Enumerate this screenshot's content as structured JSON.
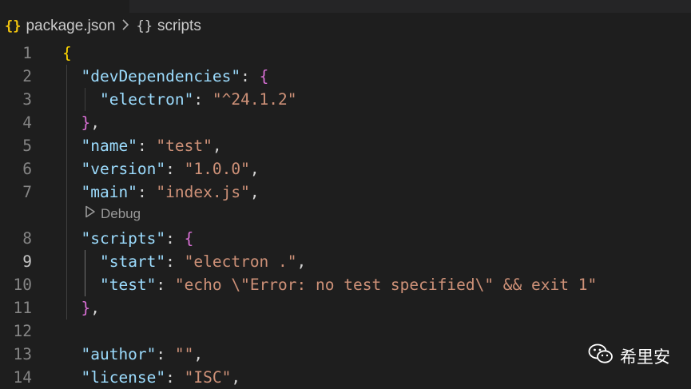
{
  "breadcrumb": {
    "file_icon": "{}",
    "file": "package.json",
    "separator": "chevron-right-icon",
    "section_icon": "{}",
    "section": "scripts"
  },
  "code_lens": {
    "label": "Debug",
    "icon": "play-icon"
  },
  "lines": [
    {
      "n": "1",
      "seg": [
        {
          "t": "{",
          "c": "b1"
        }
      ]
    },
    {
      "n": "2",
      "seg": [
        {
          "t": "  "
        },
        {
          "t": "\"devDependencies\"",
          "c": "key"
        },
        {
          "t": ": "
        },
        {
          "t": "{",
          "c": "b2"
        }
      ]
    },
    {
      "n": "3",
      "seg": [
        {
          "t": "    "
        },
        {
          "t": "\"electron\"",
          "c": "key"
        },
        {
          "t": ": "
        },
        {
          "t": "\"^24.1.2\"",
          "c": "str"
        }
      ]
    },
    {
      "n": "4",
      "seg": [
        {
          "t": "  "
        },
        {
          "t": "}",
          "c": "b2"
        },
        {
          "t": ","
        }
      ]
    },
    {
      "n": "5",
      "seg": [
        {
          "t": "  "
        },
        {
          "t": "\"name\"",
          "c": "key"
        },
        {
          "t": ": "
        },
        {
          "t": "\"test\"",
          "c": "str"
        },
        {
          "t": ","
        }
      ]
    },
    {
      "n": "6",
      "seg": [
        {
          "t": "  "
        },
        {
          "t": "\"version\"",
          "c": "key"
        },
        {
          "t": ": "
        },
        {
          "t": "\"1.0.0\"",
          "c": "str"
        },
        {
          "t": ","
        }
      ]
    },
    {
      "n": "7",
      "seg": [
        {
          "t": "  "
        },
        {
          "t": "\"main\"",
          "c": "key"
        },
        {
          "t": ": "
        },
        {
          "t": "\"index.js\"",
          "c": "str"
        },
        {
          "t": ","
        }
      ]
    },
    {
      "n": "8",
      "seg": [
        {
          "t": "  "
        },
        {
          "t": "\"scripts\"",
          "c": "key"
        },
        {
          "t": ": "
        },
        {
          "t": "{",
          "c": "b2"
        }
      ]
    },
    {
      "n": "9",
      "active": true,
      "seg": [
        {
          "t": "    "
        },
        {
          "t": "\"start\"",
          "c": "key"
        },
        {
          "t": ": "
        },
        {
          "t": "\"electron .\"",
          "c": "str"
        },
        {
          "t": ","
        }
      ]
    },
    {
      "n": "10",
      "seg": [
        {
          "t": "    "
        },
        {
          "t": "\"test\"",
          "c": "key"
        },
        {
          "t": ": "
        },
        {
          "t": "\"echo \\\"Error: no test specified\\\" && exit 1\"",
          "c": "str"
        }
      ]
    },
    {
      "n": "11",
      "seg": [
        {
          "t": "  "
        },
        {
          "t": "}",
          "c": "b2"
        },
        {
          "t": ","
        }
      ]
    },
    {
      "n": "12",
      "seg": []
    },
    {
      "n": "13",
      "seg": [
        {
          "t": "  "
        },
        {
          "t": "\"author\"",
          "c": "key"
        },
        {
          "t": ": "
        },
        {
          "t": "\"\"",
          "c": "str"
        },
        {
          "t": ","
        }
      ]
    },
    {
      "n": "14",
      "seg": [
        {
          "t": "  "
        },
        {
          "t": "\"license\"",
          "c": "key"
        },
        {
          "t": ": "
        },
        {
          "t": "\"ISC\"",
          "c": "str"
        },
        {
          "t": ","
        }
      ]
    }
  ],
  "watermark": {
    "text": "希里安",
    "icon": "wechat-icon"
  },
  "colors": {
    "background": "#1e1e1e",
    "key": "#9cdcfe",
    "string": "#ce9178",
    "bracket_level1": "#ffd700",
    "bracket_level2": "#da70d6",
    "line_number": "#858585",
    "line_number_active": "#c6c6c6"
  }
}
